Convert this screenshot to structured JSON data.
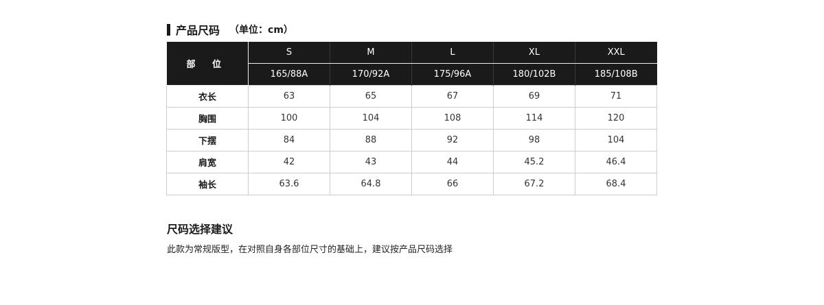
{
  "section": {
    "title": "产品尺码",
    "unit": "（单位：cm）"
  },
  "table": {
    "part_header": "部 位",
    "sizes": [
      "S",
      "M",
      "L",
      "XL",
      "XXL"
    ],
    "heights": [
      "165/88A",
      "170/92A",
      "175/96A",
      "180/102B",
      "185/108B"
    ],
    "rows": [
      {
        "part": "衣长",
        "values": [
          "63",
          "65",
          "67",
          "69",
          "71"
        ]
      },
      {
        "part": "胸围",
        "values": [
          "100",
          "104",
          "108",
          "114",
          "120"
        ]
      },
      {
        "part": "下摆",
        "values": [
          "84",
          "88",
          "92",
          "98",
          "104"
        ]
      },
      {
        "part": "肩宽",
        "values": [
          "42",
          "43",
          "44",
          "45.2",
          "46.4"
        ]
      },
      {
        "part": "袖长",
        "values": [
          "63.6",
          "64.8",
          "66",
          "67.2",
          "68.4"
        ]
      }
    ]
  },
  "advice": {
    "title": "尺码选择建议",
    "text": "此款为常规版型，在对照自身各部位尺寸的基础上，建议按产品尺码选择"
  }
}
